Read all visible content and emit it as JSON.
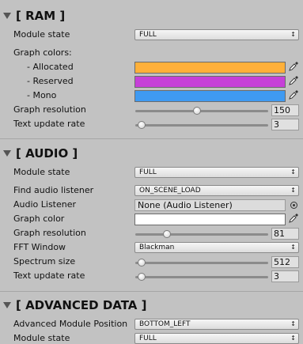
{
  "ram": {
    "title": "[ RAM ]",
    "module_state_label": "Module state",
    "module_state_value": "FULL",
    "graph_colors_label": "Graph colors:",
    "allocated_label": "- Allocated",
    "allocated_color": "#ffb03a",
    "reserved_label": "- Reserved",
    "reserved_color": "#c640d8",
    "mono_label": "- Mono",
    "mono_color": "#3f9af2",
    "graph_resolution_label": "Graph resolution",
    "graph_resolution_value": "150",
    "graph_resolution_fraction": 0.46,
    "text_update_rate_label": "Text update rate",
    "text_update_rate_value": "3",
    "text_update_rate_fraction": 0.02
  },
  "audio": {
    "title": "[ AUDIO ]",
    "module_state_label": "Module state",
    "module_state_value": "FULL",
    "find_audio_listener_label": "Find audio listener",
    "find_audio_listener_value": "ON_SCENE_LOAD",
    "audio_listener_label": "Audio Listener",
    "audio_listener_value": "None (Audio Listener)",
    "graph_color_label": "Graph color",
    "graph_color": "#ffffff",
    "graph_resolution_label": "Graph resolution",
    "graph_resolution_value": "81",
    "graph_resolution_fraction": 0.22,
    "fft_window_label": "FFT Window",
    "fft_window_value": "Blackman",
    "spectrum_size_label": "Spectrum size",
    "spectrum_size_value": "512",
    "spectrum_size_fraction": 0.02,
    "text_update_rate_label": "Text update rate",
    "text_update_rate_value": "3",
    "text_update_rate_fraction": 0.02
  },
  "advanced": {
    "title": "[ ADVANCED DATA ]",
    "position_label": "Advanced Module Position",
    "position_value": "BOTTOM_LEFT",
    "module_state_label": "Module state",
    "module_state_value": "FULL"
  },
  "icons": {
    "foldout": "triangle-down",
    "dropdown": "up-down-arrows",
    "picker": "eyedropper",
    "object_target": "circle-dot"
  },
  "colors": {
    "background": "#c2c2c2"
  }
}
